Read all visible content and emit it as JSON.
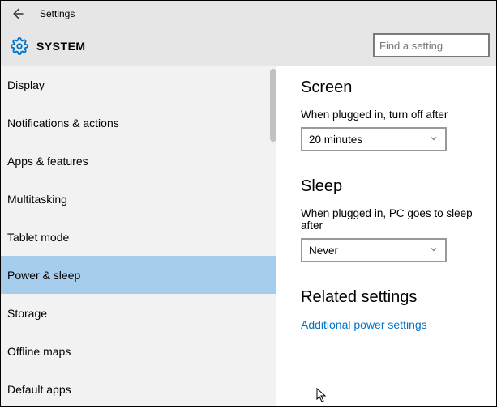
{
  "titlebar": {
    "title": "Settings"
  },
  "header": {
    "system_label": "SYSTEM"
  },
  "search": {
    "placeholder": "Find a setting"
  },
  "sidebar": {
    "items": [
      {
        "label": "Display"
      },
      {
        "label": "Notifications & actions"
      },
      {
        "label": "Apps & features"
      },
      {
        "label": "Multitasking"
      },
      {
        "label": "Tablet mode"
      },
      {
        "label": "Power & sleep"
      },
      {
        "label": "Storage"
      },
      {
        "label": "Offline maps"
      },
      {
        "label": "Default apps"
      }
    ],
    "selected_index": 5
  },
  "main": {
    "screen": {
      "heading": "Screen",
      "plugged_label": "When plugged in, turn off after",
      "plugged_value": "20 minutes"
    },
    "sleep": {
      "heading": "Sleep",
      "plugged_label": "When plugged in, PC goes to sleep after",
      "plugged_value": "Never"
    },
    "related": {
      "heading": "Related settings",
      "link": "Additional power settings"
    }
  }
}
